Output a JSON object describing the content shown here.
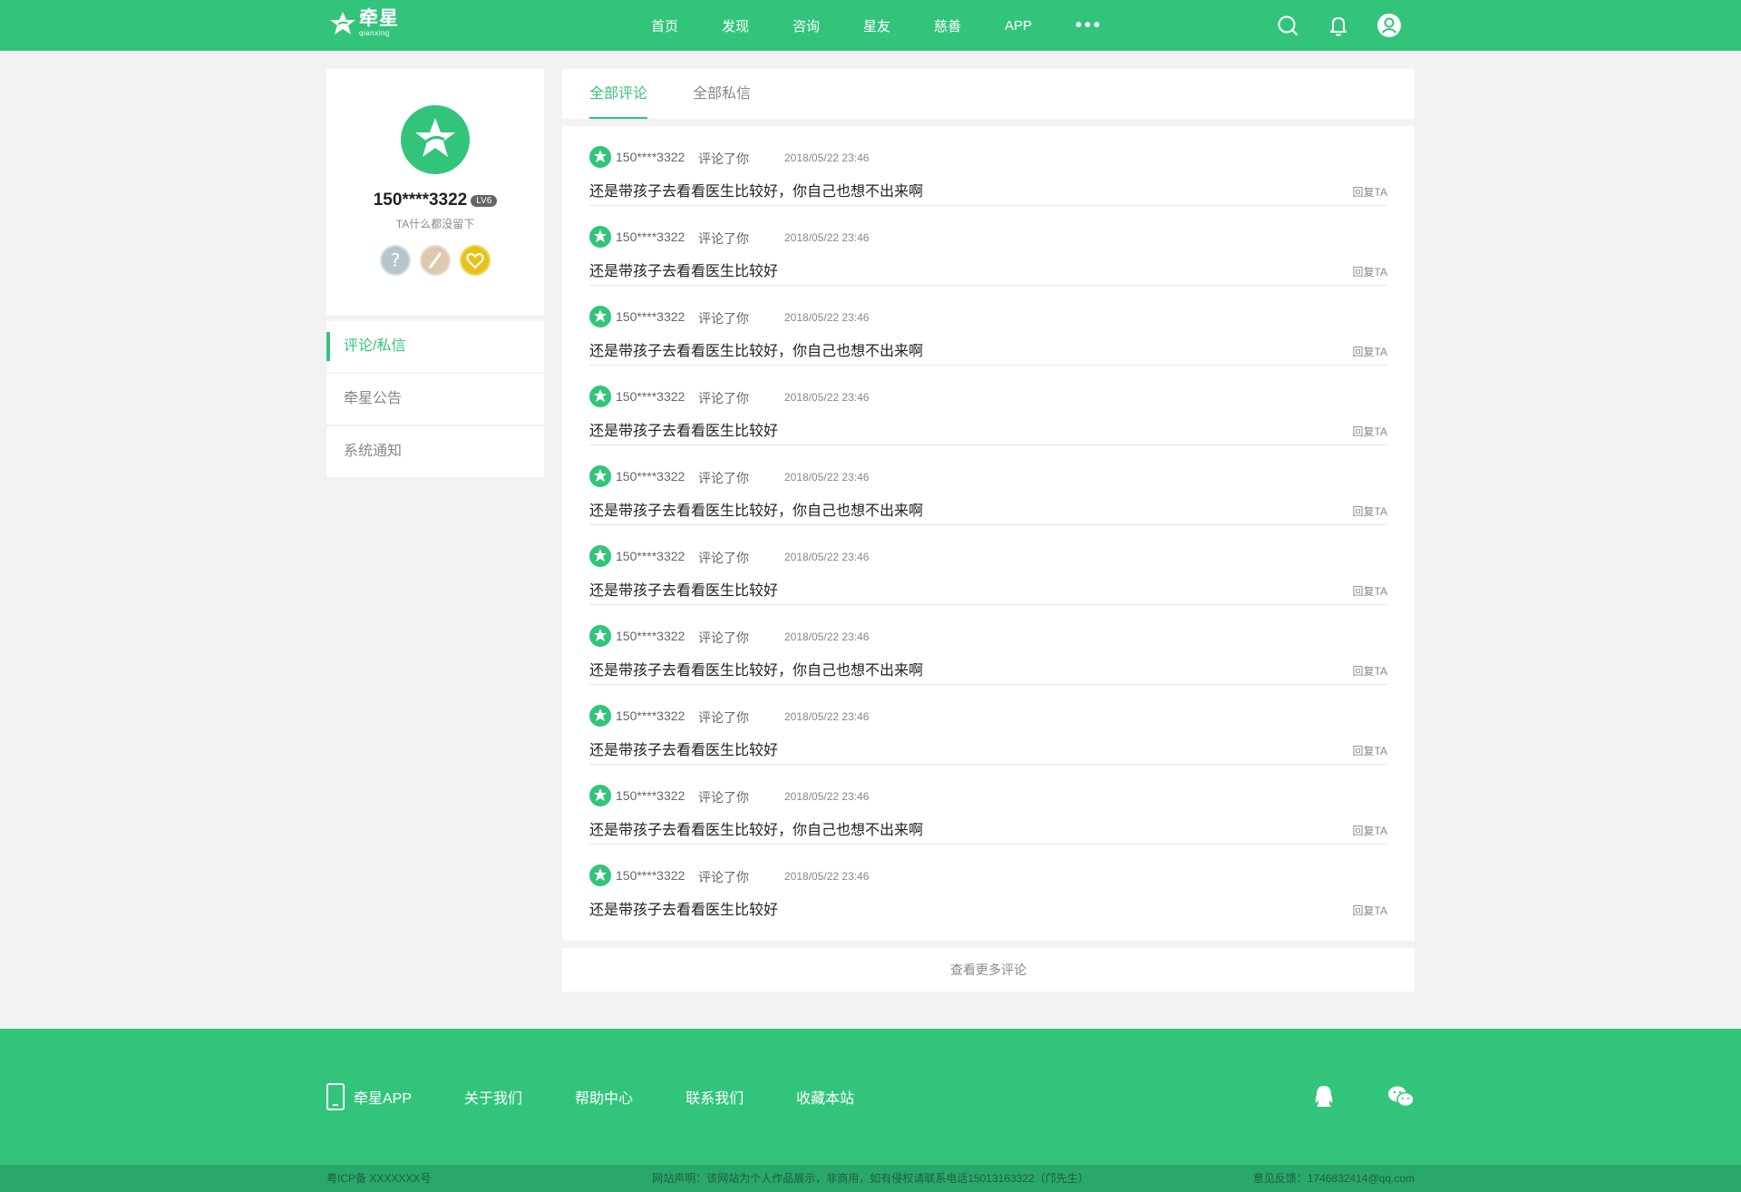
{
  "header": {
    "logo_cn": "牵星",
    "logo_en": "qianxing",
    "nav": [
      "首页",
      "发现",
      "咨询",
      "星友",
      "慈善",
      "APP"
    ],
    "more": "•••",
    "icons": [
      "search-icon",
      "bell-icon",
      "user-icon"
    ]
  },
  "profile": {
    "name": "150****3322",
    "level": "LV6",
    "bio": "TA什么都没留下",
    "badges": [
      "question-badge",
      "pen-badge",
      "heart-badge"
    ]
  },
  "menu": [
    "评论/私信",
    "牵星公告",
    "系统通知"
  ],
  "tabs": [
    "全部评论",
    "全部私信"
  ],
  "comments": [
    {
      "user": "150****3322",
      "action": "评论了你",
      "time": "2018/05/22  23:46",
      "text": "还是带孩子去看看医生比较好，你自己也想不出来啊",
      "reply": "回复TA"
    },
    {
      "user": "150****3322",
      "action": "评论了你",
      "time": "2018/05/22  23:46",
      "text": "还是带孩子去看看医生比较好",
      "reply": "回复TA"
    },
    {
      "user": "150****3322",
      "action": "评论了你",
      "time": "2018/05/22  23:46",
      "text": "还是带孩子去看看医生比较好，你自己也想不出来啊",
      "reply": "回复TA"
    },
    {
      "user": "150****3322",
      "action": "评论了你",
      "time": "2018/05/22  23:46",
      "text": "还是带孩子去看看医生比较好",
      "reply": "回复TA"
    },
    {
      "user": "150****3322",
      "action": "评论了你",
      "time": "2018/05/22  23:46",
      "text": "还是带孩子去看看医生比较好，你自己也想不出来啊",
      "reply": "回复TA"
    },
    {
      "user": "150****3322",
      "action": "评论了你",
      "time": "2018/05/22  23:46",
      "text": "还是带孩子去看看医生比较好",
      "reply": "回复TA"
    },
    {
      "user": "150****3322",
      "action": "评论了你",
      "time": "2018/05/22  23:46",
      "text": "还是带孩子去看看医生比较好，你自己也想不出来啊",
      "reply": "回复TA"
    },
    {
      "user": "150****3322",
      "action": "评论了你",
      "time": "2018/05/22  23:46",
      "text": "还是带孩子去看看医生比较好",
      "reply": "回复TA"
    },
    {
      "user": "150****3322",
      "action": "评论了你",
      "time": "2018/05/22  23:46",
      "text": "还是带孩子去看看医生比较好，你自己也想不出来啊",
      "reply": "回复TA"
    },
    {
      "user": "150****3322",
      "action": "评论了你",
      "time": "2018/05/22  23:46",
      "text": "还是带孩子去看看医生比较好",
      "reply": "回复TA"
    }
  ],
  "more_label": "查看更多评论",
  "footer": {
    "links": [
      "牵星APP",
      "关于我们",
      "帮助中心",
      "联系我们",
      "收藏本站"
    ],
    "icp": "粤ICP备 XXXXXXX号",
    "notice": "网站声明：该网站为个人作品展示，非商用，如有侵权请联系电话15013163322（邝先生）",
    "feedback": "意见反馈：1746832414@qq.com"
  },
  "colors": {
    "accent": "#33c47c",
    "footer_bar": "#2aa76a",
    "badge_grey": "#b8c6cc",
    "badge_beige": "#dcc9b0",
    "badge_gold": "#e6c21b"
  }
}
